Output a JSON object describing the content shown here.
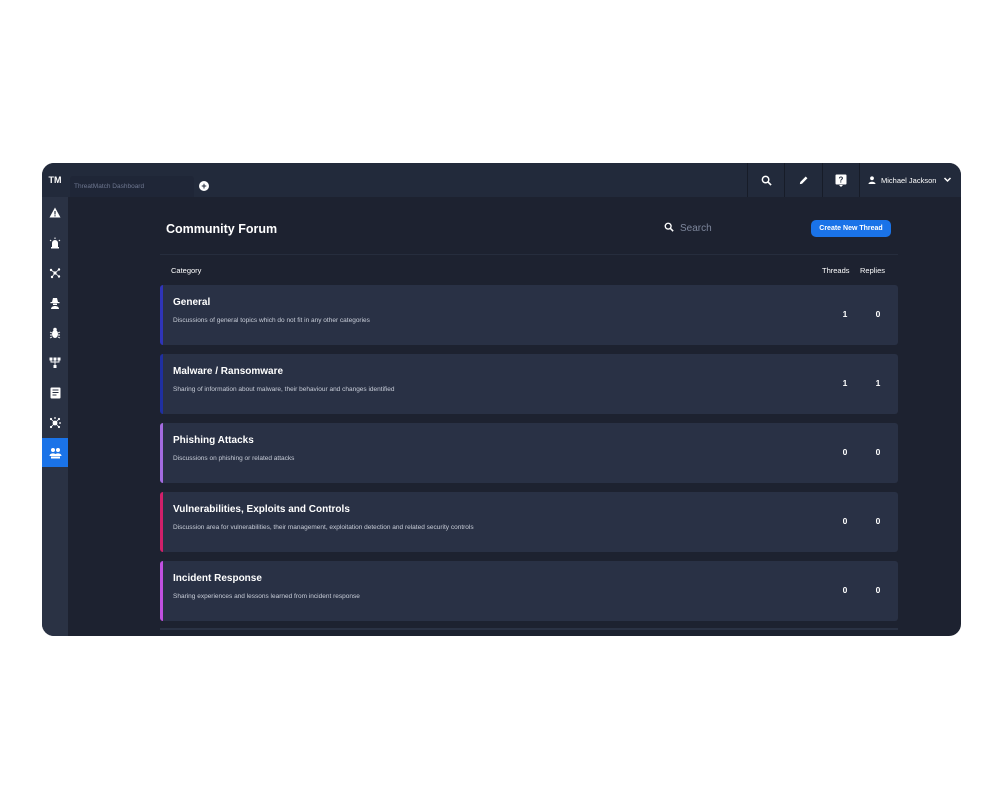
{
  "app": {
    "logo": "TM",
    "tab_title": "ThreatMatch Dashboard",
    "add_tab": "+",
    "user_name": "Michael Jackson"
  },
  "forum": {
    "title": "Community Forum",
    "search_placeholder": "Search",
    "create_button": "Create New Thread",
    "columns": {
      "category": "Category",
      "threads": "Threads",
      "replies": "Replies"
    },
    "categories": [
      {
        "name": "General",
        "description": "Discussions of general topics which do not fit in any other categories",
        "threads": "1",
        "replies": "0",
        "accent": "#2f34b8"
      },
      {
        "name": "Malware / Ransomware",
        "description": "Sharing of information about malware, their behaviour and changes identified",
        "threads": "1",
        "replies": "1",
        "accent": "#1f2fa0"
      },
      {
        "name": "Phishing Attacks",
        "description": "Discussions on phishing or related attacks",
        "threads": "0",
        "replies": "0",
        "accent": "#a36be0"
      },
      {
        "name": "Vulnerabilities, Exploits and Controls",
        "description": "Discussion area for vulnerabilities, their management, exploitation detection and related security controls",
        "threads": "0",
        "replies": "0",
        "accent": "#d0206a"
      },
      {
        "name": "Incident Response",
        "description": "Sharing experiences and lessons learned from incident response",
        "threads": "0",
        "replies": "0",
        "accent": "#c050e0"
      }
    ]
  },
  "sidebar": {
    "items": [
      {
        "icon": "alert-icon",
        "active": false
      },
      {
        "icon": "siren-icon",
        "active": false
      },
      {
        "icon": "network-icon",
        "active": false
      },
      {
        "icon": "hacker-icon",
        "active": false
      },
      {
        "icon": "bug-icon",
        "active": false
      },
      {
        "icon": "hierarchy-icon",
        "active": false
      },
      {
        "icon": "report-icon",
        "active": false
      },
      {
        "icon": "virus-icon",
        "active": false
      },
      {
        "icon": "community-icon",
        "active": true
      }
    ]
  },
  "colors": {
    "accent_blue": "#1a73e8",
    "background": "#1d2230",
    "row_background": "#293145"
  }
}
